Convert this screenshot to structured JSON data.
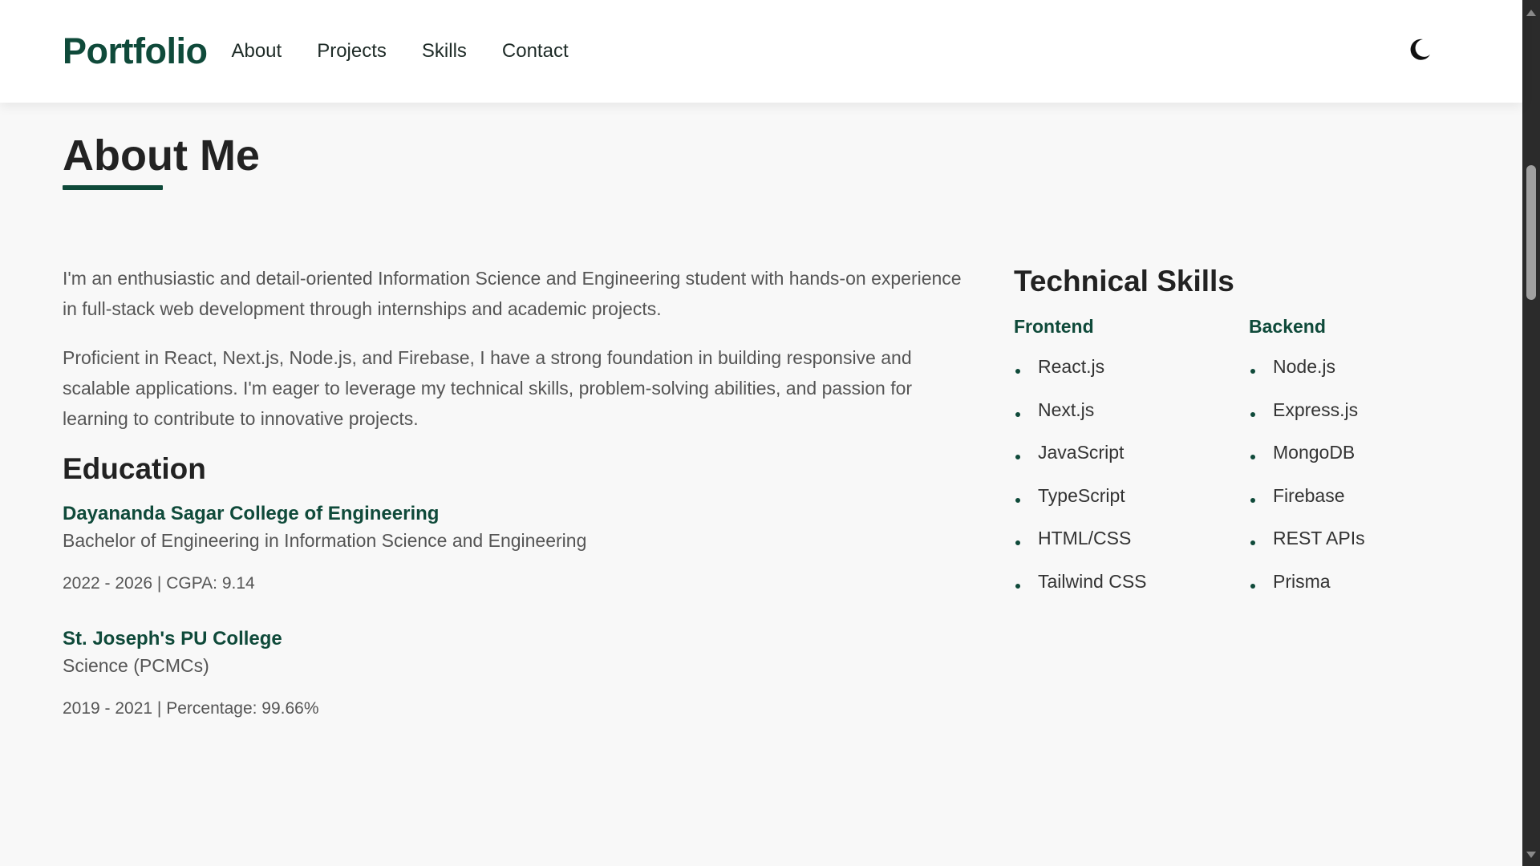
{
  "nav": {
    "brand": "Portfolio",
    "links": [
      "About",
      "Projects",
      "Skills",
      "Contact"
    ],
    "theme_toggle_icon": "moon-icon"
  },
  "about": {
    "title": "About Me",
    "paragraphs": [
      "I'm an enthusiastic and detail-oriented Information Science and Engineering student with hands-on experience in full-stack web development through internships and academic projects.",
      "Proficient in React, Next.js, Node.js, and Firebase, I have a strong foundation in building responsive and scalable applications. I'm eager to leverage my technical skills, problem-solving abilities, and passion for learning to contribute to innovative projects."
    ]
  },
  "education": {
    "title": "Education",
    "items": [
      {
        "school": "Dayananda Sagar College of Engineering",
        "degree": "Bachelor of Engineering in Information Science and Engineering",
        "meta": "2022 - 2026 | CGPA: 9.14"
      },
      {
        "school": "St. Joseph's PU College",
        "degree": "Science (PCMCs)",
        "meta": "2019 - 2021 | Percentage: 99.66%"
      }
    ]
  },
  "skills": {
    "title": "Technical Skills",
    "groups": [
      {
        "name": "Frontend",
        "items": [
          "React.js",
          "Next.js",
          "JavaScript",
          "TypeScript",
          "HTML/CSS",
          "Tailwind CSS"
        ]
      },
      {
        "name": "Backend",
        "items": [
          "Node.js",
          "Express.js",
          "MongoDB",
          "Firebase",
          "REST APIs",
          "Prisma"
        ]
      }
    ]
  },
  "colors": {
    "accent": "#0f4a3a",
    "background": "#f8f8f8",
    "text": "#222222",
    "muted_text": "#555555"
  }
}
